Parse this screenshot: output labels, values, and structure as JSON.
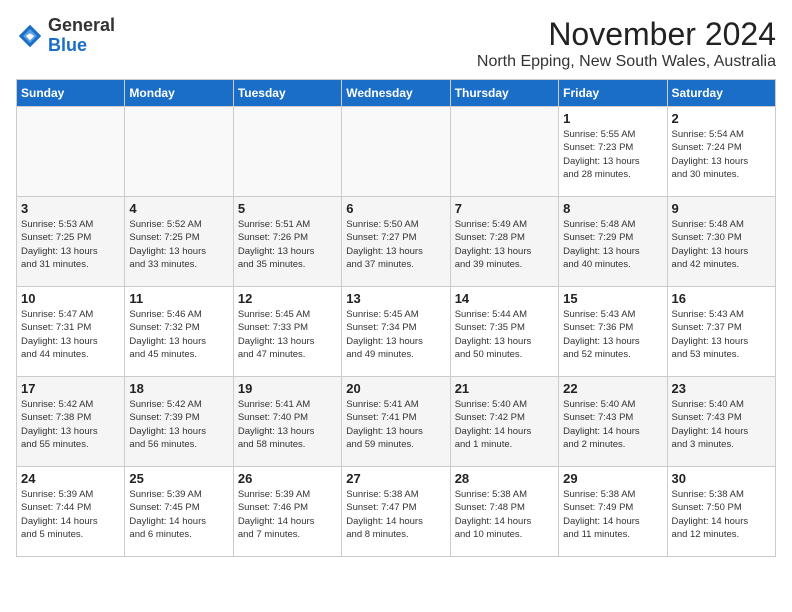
{
  "logo": {
    "general": "General",
    "blue": "Blue"
  },
  "title": "November 2024",
  "location": "North Epping, New South Wales, Australia",
  "days_of_week": [
    "Sunday",
    "Monday",
    "Tuesday",
    "Wednesday",
    "Thursday",
    "Friday",
    "Saturday"
  ],
  "weeks": [
    [
      {
        "day": "",
        "detail": ""
      },
      {
        "day": "",
        "detail": ""
      },
      {
        "day": "",
        "detail": ""
      },
      {
        "day": "",
        "detail": ""
      },
      {
        "day": "",
        "detail": ""
      },
      {
        "day": "1",
        "detail": "Sunrise: 5:55 AM\nSunset: 7:23 PM\nDaylight: 13 hours\nand 28 minutes."
      },
      {
        "day": "2",
        "detail": "Sunrise: 5:54 AM\nSunset: 7:24 PM\nDaylight: 13 hours\nand 30 minutes."
      }
    ],
    [
      {
        "day": "3",
        "detail": "Sunrise: 5:53 AM\nSunset: 7:25 PM\nDaylight: 13 hours\nand 31 minutes."
      },
      {
        "day": "4",
        "detail": "Sunrise: 5:52 AM\nSunset: 7:25 PM\nDaylight: 13 hours\nand 33 minutes."
      },
      {
        "day": "5",
        "detail": "Sunrise: 5:51 AM\nSunset: 7:26 PM\nDaylight: 13 hours\nand 35 minutes."
      },
      {
        "day": "6",
        "detail": "Sunrise: 5:50 AM\nSunset: 7:27 PM\nDaylight: 13 hours\nand 37 minutes."
      },
      {
        "day": "7",
        "detail": "Sunrise: 5:49 AM\nSunset: 7:28 PM\nDaylight: 13 hours\nand 39 minutes."
      },
      {
        "day": "8",
        "detail": "Sunrise: 5:48 AM\nSunset: 7:29 PM\nDaylight: 13 hours\nand 40 minutes."
      },
      {
        "day": "9",
        "detail": "Sunrise: 5:48 AM\nSunset: 7:30 PM\nDaylight: 13 hours\nand 42 minutes."
      }
    ],
    [
      {
        "day": "10",
        "detail": "Sunrise: 5:47 AM\nSunset: 7:31 PM\nDaylight: 13 hours\nand 44 minutes."
      },
      {
        "day": "11",
        "detail": "Sunrise: 5:46 AM\nSunset: 7:32 PM\nDaylight: 13 hours\nand 45 minutes."
      },
      {
        "day": "12",
        "detail": "Sunrise: 5:45 AM\nSunset: 7:33 PM\nDaylight: 13 hours\nand 47 minutes."
      },
      {
        "day": "13",
        "detail": "Sunrise: 5:45 AM\nSunset: 7:34 PM\nDaylight: 13 hours\nand 49 minutes."
      },
      {
        "day": "14",
        "detail": "Sunrise: 5:44 AM\nSunset: 7:35 PM\nDaylight: 13 hours\nand 50 minutes."
      },
      {
        "day": "15",
        "detail": "Sunrise: 5:43 AM\nSunset: 7:36 PM\nDaylight: 13 hours\nand 52 minutes."
      },
      {
        "day": "16",
        "detail": "Sunrise: 5:43 AM\nSunset: 7:37 PM\nDaylight: 13 hours\nand 53 minutes."
      }
    ],
    [
      {
        "day": "17",
        "detail": "Sunrise: 5:42 AM\nSunset: 7:38 PM\nDaylight: 13 hours\nand 55 minutes."
      },
      {
        "day": "18",
        "detail": "Sunrise: 5:42 AM\nSunset: 7:39 PM\nDaylight: 13 hours\nand 56 minutes."
      },
      {
        "day": "19",
        "detail": "Sunrise: 5:41 AM\nSunset: 7:40 PM\nDaylight: 13 hours\nand 58 minutes."
      },
      {
        "day": "20",
        "detail": "Sunrise: 5:41 AM\nSunset: 7:41 PM\nDaylight: 13 hours\nand 59 minutes."
      },
      {
        "day": "21",
        "detail": "Sunrise: 5:40 AM\nSunset: 7:42 PM\nDaylight: 14 hours\nand 1 minute."
      },
      {
        "day": "22",
        "detail": "Sunrise: 5:40 AM\nSunset: 7:43 PM\nDaylight: 14 hours\nand 2 minutes."
      },
      {
        "day": "23",
        "detail": "Sunrise: 5:40 AM\nSunset: 7:43 PM\nDaylight: 14 hours\nand 3 minutes."
      }
    ],
    [
      {
        "day": "24",
        "detail": "Sunrise: 5:39 AM\nSunset: 7:44 PM\nDaylight: 14 hours\nand 5 minutes."
      },
      {
        "day": "25",
        "detail": "Sunrise: 5:39 AM\nSunset: 7:45 PM\nDaylight: 14 hours\nand 6 minutes."
      },
      {
        "day": "26",
        "detail": "Sunrise: 5:39 AM\nSunset: 7:46 PM\nDaylight: 14 hours\nand 7 minutes."
      },
      {
        "day": "27",
        "detail": "Sunrise: 5:38 AM\nSunset: 7:47 PM\nDaylight: 14 hours\nand 8 minutes."
      },
      {
        "day": "28",
        "detail": "Sunrise: 5:38 AM\nSunset: 7:48 PM\nDaylight: 14 hours\nand 10 minutes."
      },
      {
        "day": "29",
        "detail": "Sunrise: 5:38 AM\nSunset: 7:49 PM\nDaylight: 14 hours\nand 11 minutes."
      },
      {
        "day": "30",
        "detail": "Sunrise: 5:38 AM\nSunset: 7:50 PM\nDaylight: 14 hours\nand 12 minutes."
      }
    ]
  ]
}
